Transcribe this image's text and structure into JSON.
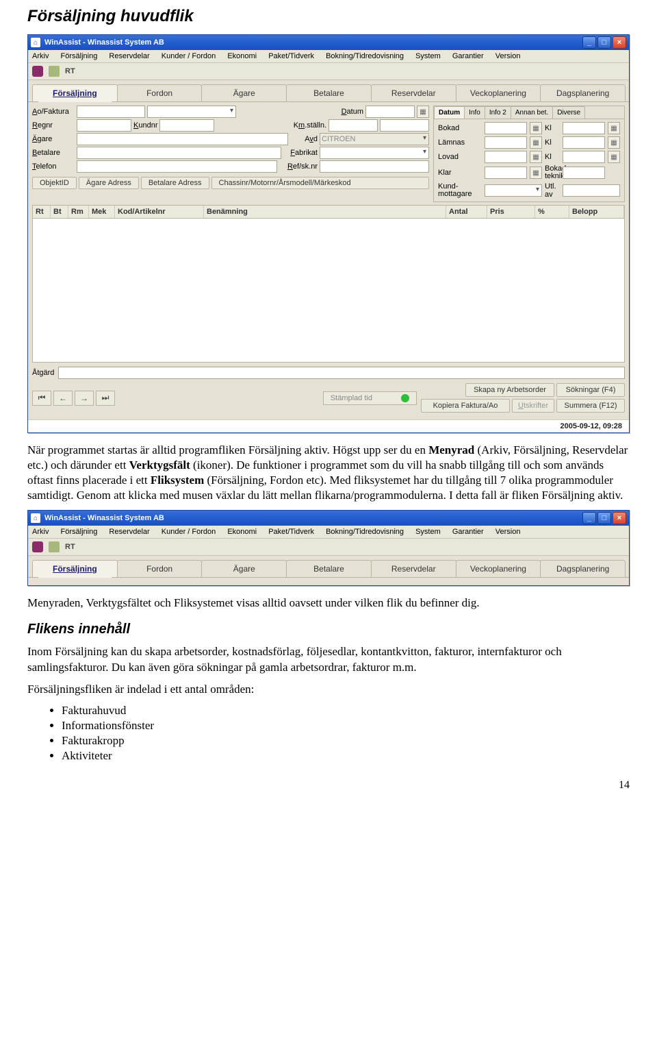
{
  "doc": {
    "title": "Försäljning huvudflik",
    "para1_a": "När programmet startas är alltid programfliken Försäljning aktiv. Högst upp ser du en ",
    "para1_b": "Menyrad",
    "para1_c": " (Arkiv, Försäljning, Reservdelar etc.) och därunder ett ",
    "para1_d": "Verktygsfält",
    "para1_e": " (ikoner). De funktioner i programmet som du vill ha snabb tillgång till och som används oftast finns placerade i ett ",
    "para1_f": "Fliksystem",
    "para1_g": " (Försäljning, Fordon etc). Med fliksystemet har du tillgång till 7 olika programmoduler samtidigt. Genom att klicka med musen växlar du lätt mellan flikarna/programmodulerna. I detta fall är fliken Försäljning aktiv.",
    "para2": "Menyraden, Verktygsfältet och Fliksystemet visas alltid oavsett under vilken flik du befinner dig.",
    "subtitle": "Flikens innehåll",
    "para3": "Inom Försäljning kan du skapa arbetsorder, kostnadsförlag, följesedlar, kontantkvitton, fakturor, internfakturor och samlingsfakturor. Du kan även göra sökningar på gamla arbetsordrar, fakturor m.m.",
    "para4": "Försäljningsfliken är indelad i ett antal områden:",
    "bullets": [
      "Fakturahuvud",
      "Informationsfönster",
      "Fakturakropp",
      "Aktiviteter"
    ],
    "page_num": "14"
  },
  "app": {
    "title": "WinAssist - Winassist System AB",
    "menu": [
      "Arkiv",
      "Försäljning",
      "Reservdelar",
      "Kunder / Fordon",
      "Ekonomi",
      "Paket/Tidverk",
      "Bokning/Tidredovisning",
      "System",
      "Garantier",
      "Version"
    ],
    "rt": "RT",
    "tabs": [
      "Försäljning",
      "Fordon",
      "Ägare",
      "Betalare",
      "Reservdelar",
      "Veckoplanering",
      "Dagsplanering"
    ],
    "form": {
      "aofaktura": "Ao/Faktura",
      "datum": "Datum",
      "regnr": "Regnr",
      "kundnr": "Kundnr",
      "kmstalln": "Km.ställn.",
      "agare": "Ägare",
      "avd": "Avd",
      "avd_val": "CITROEN",
      "betalare": "Betalare",
      "fabrikat": "Fabrikat",
      "telefon": "Telefon",
      "refsknr": "Ref/sk.nr"
    },
    "midbtns": [
      "ObjektID",
      "Ägare Adress",
      "Betalare Adress",
      "Chassinr/Motornr/Årsmodell/Märkeskod"
    ],
    "rtabs": [
      "Datum",
      "Info",
      "Info 2",
      "Annan bet.",
      "Diverse"
    ],
    "rfields": {
      "bokad": "Bokad",
      "lamnas": "Lämnas",
      "lovad": "Lovad",
      "klar": "Klar",
      "kundmottagare": "Kund-\nmottagare",
      "kl": "Kl",
      "bokad_tekniker": "Bokad\ntekniker",
      "utl_av": "Utl. av"
    },
    "gridcols": [
      "Rt",
      "Bt",
      "Rm",
      "Mek",
      "Kod/Artikelnr",
      "Benämning",
      "Antal",
      "Pris",
      "%",
      "Belopp"
    ],
    "atgard": "Åtgärd",
    "stamp": "Stämplad tid",
    "btns": {
      "skapa": "Skapa ny Arbetsorder",
      "sok": "Sökningar (F4)",
      "kopiera": "Kopiera Faktura/Ao",
      "utskrifter": "Utskrifter",
      "summera": "Summera (F12)"
    },
    "status": "2005-09-12, 09:28"
  }
}
